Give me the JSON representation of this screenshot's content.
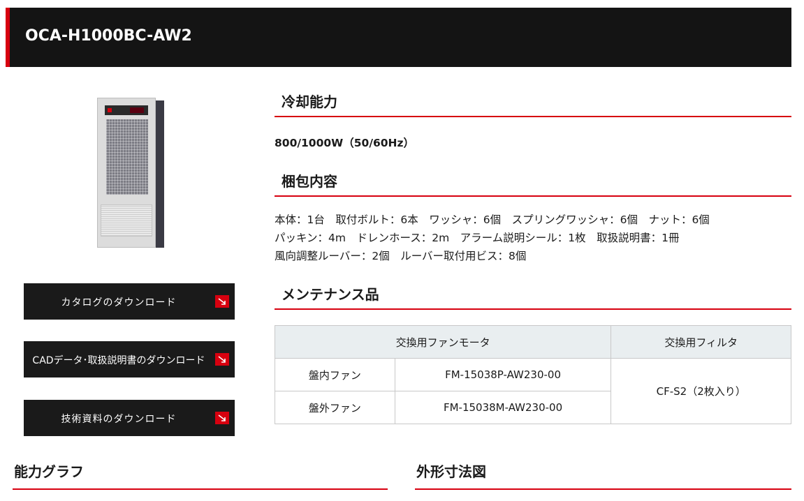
{
  "product": {
    "model": "OCA-H1000BC-AW2",
    "image_alt": "product-photo"
  },
  "downloads": [
    {
      "label": "カタログのダウンロード"
    },
    {
      "label": "CADデータ･取扱説明書のダウンロード"
    },
    {
      "label": "技術資料のダウンロード"
    }
  ],
  "cooling": {
    "title": "冷却能力",
    "value": "800/1000W（50/60Hz）"
  },
  "packing": {
    "title": "梱包内容",
    "lines": [
      "本体：1台　取付ボルト：6本　ワッシャ：6個　スプリングワッシャ：6個　ナット：6個",
      "パッキン：4m　ドレンホース：2m　アラーム説明シール：1枚　取扱説明書：1冊",
      "風向調整ルーバー：2個　ルーバー取付用ビス：8個"
    ]
  },
  "maintenance": {
    "title": "メンテナンス品",
    "headers": [
      "交換用ファンモータ",
      "交換用フィルタ"
    ],
    "rows": [
      {
        "type": "盤内ファン",
        "model": "FM-15038P-AW230-00"
      },
      {
        "type": "盤外ファン",
        "model": "FM-15038M-AW230-00"
      }
    ],
    "filter": "CF-S2（2枚入り）"
  },
  "bottom": {
    "capacity_graph": "能力グラフ",
    "dimensions": "外形寸法図"
  },
  "colors": {
    "accent": "#d7000f",
    "header_bg": "#141414",
    "button_bg": "#1a1a1a",
    "table_header_bg": "#e9eef0"
  }
}
